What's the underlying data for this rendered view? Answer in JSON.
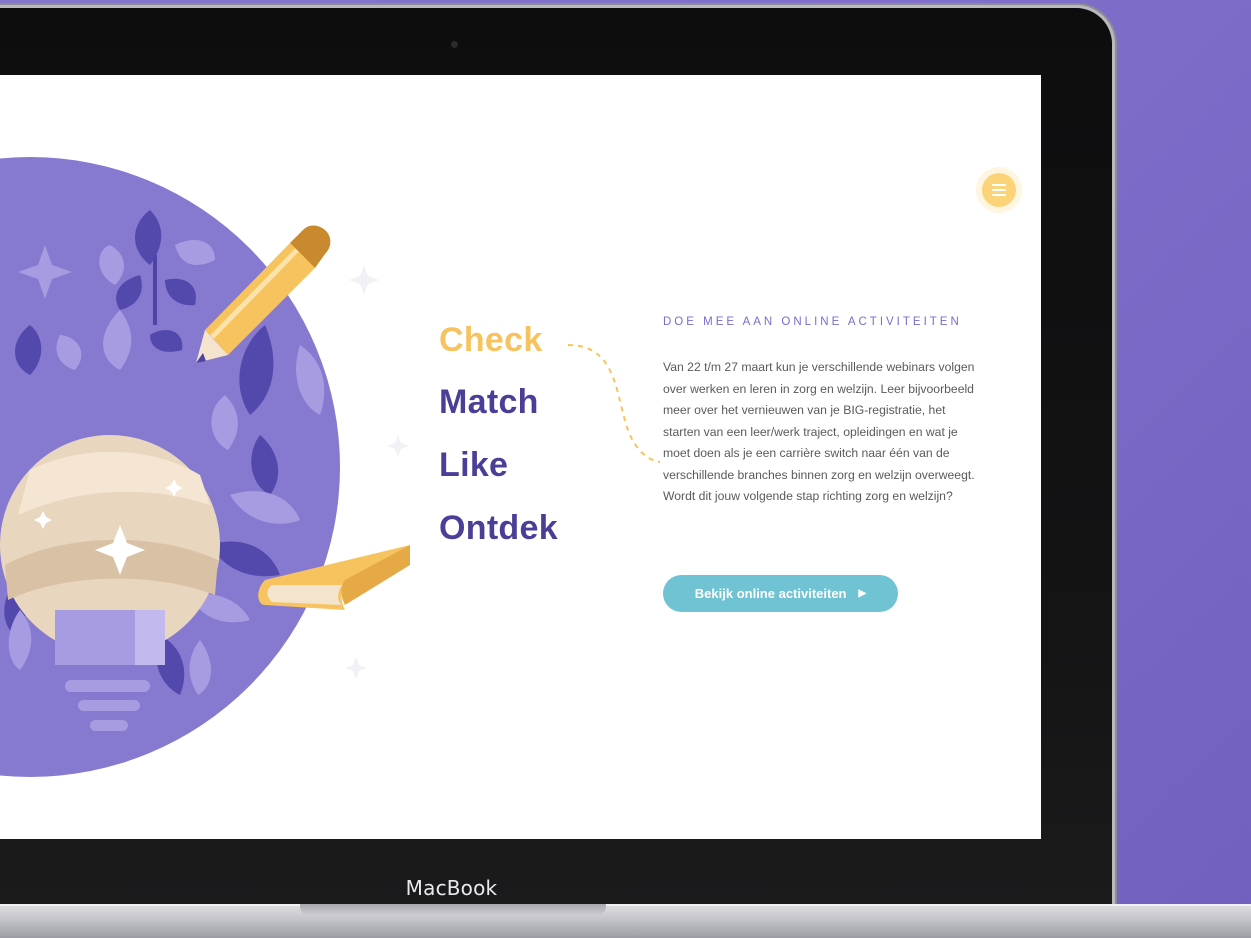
{
  "device": {
    "brand_label": "MacBook"
  },
  "header": {
    "menu_icon": "hamburger-icon"
  },
  "nav_words": [
    {
      "label": "Check",
      "active": true
    },
    {
      "label": "Match",
      "active": false
    },
    {
      "label": "Like",
      "active": false
    },
    {
      "label": "Ontdek",
      "active": false
    }
  ],
  "section": {
    "heading": "DOE MEE AAN ONLINE ACTIVITEITEN",
    "body": "Van 22 t/m 27 maart kun je verschillende webinars volgen over werken en leren in zorg en welzijn. Leer bijvoorbeeld meer over het vernieuwen van je BIG-registratie, het starten van een leer/werk traject, opleidingen en wat je moet doen als je een carrière switch naar één van de verschillende branches binnen zorg en welzijn overweegt. Wordt dit jouw volgende stap richting zorg en welzijn?",
    "cta_label": "Bekijk online activiteiten",
    "cta_icon": "chevron-right-icon"
  },
  "illustration": {
    "icons": [
      "lightbulb-icon",
      "pencil-icon",
      "book-icon",
      "leaf-icon",
      "sparkle-icon"
    ]
  },
  "colors": {
    "background": "#8474cc",
    "accent_yellow": "#f7c35f",
    "nav_purple": "#4a3f97",
    "heading_purple": "#7a6bd0",
    "cta_teal": "#70c3d3",
    "circle_purple": "#8679d0"
  }
}
